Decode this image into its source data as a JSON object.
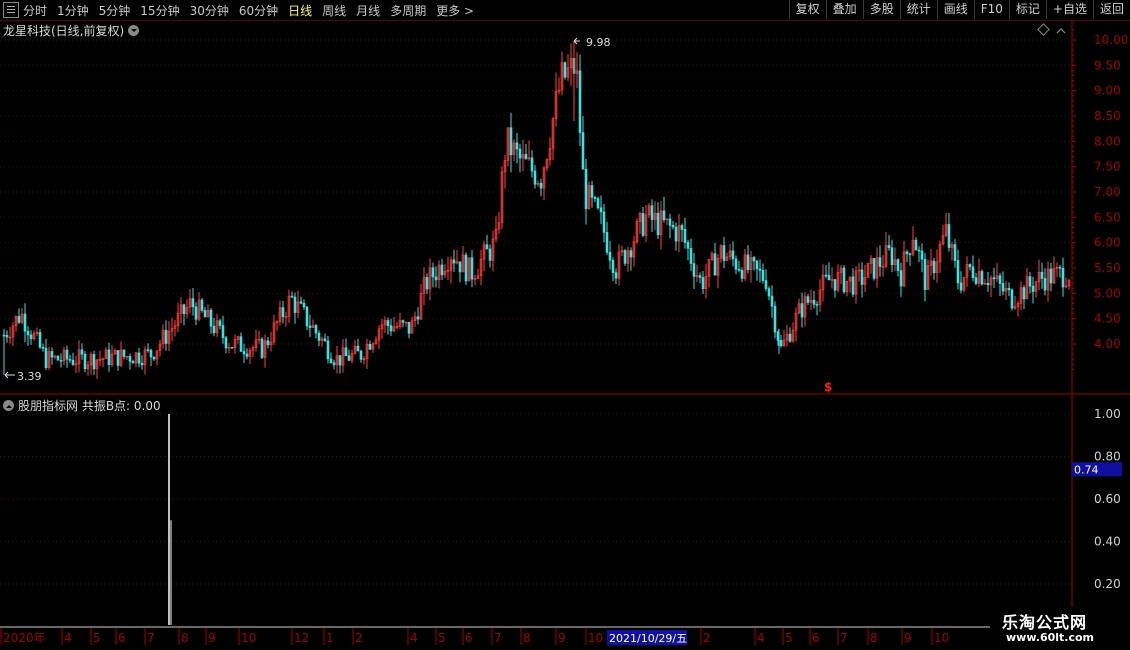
{
  "toolbar": {
    "periods": [
      "分时",
      "1分钟",
      "5分钟",
      "15分钟",
      "30分钟",
      "60分钟",
      "日线",
      "周线",
      "月线",
      "多周期",
      "更多 >"
    ],
    "active_period": "日线",
    "right_buttons": [
      "复权",
      "叠加",
      "多股",
      "统计",
      "画线",
      "F10",
      "标记",
      "+自选",
      "返回"
    ]
  },
  "main_title": "龙星科技(日线,前复权)",
  "indicator_title": "股朋指标网 共振B点: 0.00",
  "price_axis": {
    "labels": [
      "10.00",
      "9.50",
      "9.00",
      "8.50",
      "8.00",
      "7.50",
      "7.00",
      "6.50",
      "6.00",
      "5.50",
      "5.00",
      "4.50",
      "4.00"
    ]
  },
  "indicator_axis": {
    "labels": [
      "1.00",
      "0.80",
      "0.60",
      "0.40",
      "0.20"
    ],
    "highlight": "0.74"
  },
  "annotations": {
    "high": "9.98",
    "low": "3.39",
    "marker": "$"
  },
  "time_axis": {
    "labels": [
      "2020年",
      "4",
      "5",
      "6",
      "7",
      "8",
      "9",
      "10",
      "12",
      "1",
      "2",
      "4",
      "5",
      "6",
      "7",
      "8",
      "9",
      "10",
      "2",
      "4",
      "5",
      "6",
      "7",
      "8",
      "9",
      "10"
    ],
    "cursor_date": "2021/10/29/五"
  },
  "watermark": {
    "name": "乐淘公式网",
    "url": "www.60lt.com"
  },
  "colors": {
    "up": "#ff4040",
    "down": "#40e0e0",
    "axis": "#a00000",
    "grid": "#5a0000",
    "label": "#d0d0d0",
    "highlight_bg": "#1010a0"
  },
  "chart_data": {
    "type": "candlestick",
    "title": "龙星科技(日线,前复权)",
    "ylim": [
      3.2,
      10.2
    ],
    "high": 9.98,
    "low": 3.39,
    "indicator": {
      "name": "共振B点",
      "value": 0.0,
      "ylim": [
        0,
        1.05
      ],
      "spike_value": 1.0
    }
  }
}
